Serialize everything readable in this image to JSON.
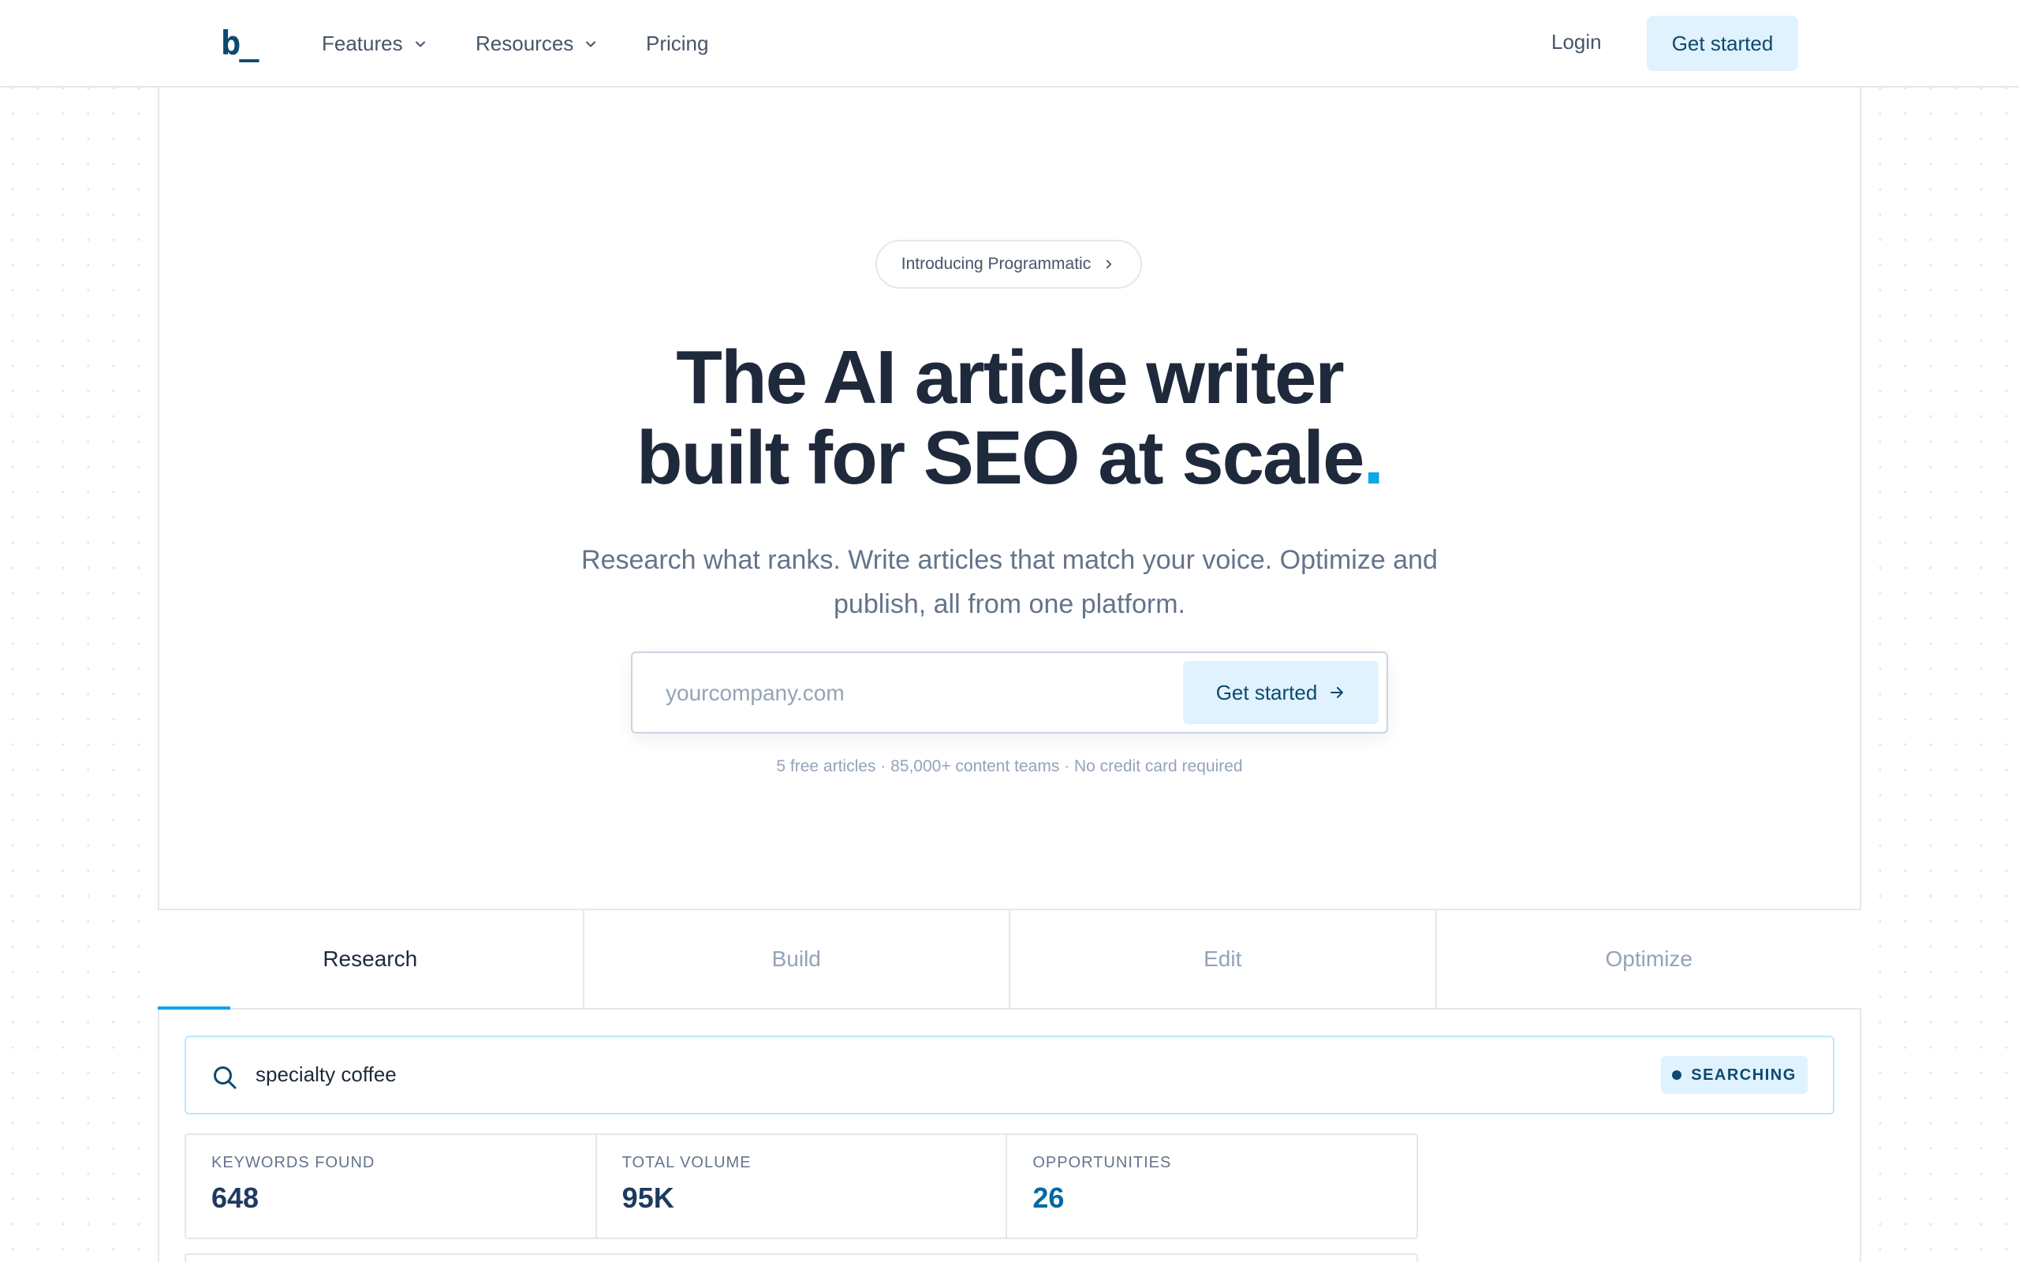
{
  "header": {
    "logo": "b_",
    "nav": [
      {
        "label": "Features",
        "has_dropdown": true
      },
      {
        "label": "Resources",
        "has_dropdown": true
      },
      {
        "label": "Pricing",
        "has_dropdown": false
      }
    ],
    "login_label": "Login",
    "cta_label": "Get started"
  },
  "hero": {
    "pill_label": "Introducing Programmatic",
    "title_line1": "The AI article writer",
    "title_line2": "built for SEO at scale",
    "title_dot": ".",
    "subtitle": "Research what ranks. Write articles that match your voice. Optimize and publish, all from one platform.",
    "email_placeholder": "yourcompany.com",
    "form_cta_label": "Get started",
    "fine_print": "5 free articles · 85,000+ content teams · No credit card required"
  },
  "tabs": [
    {
      "label": "Research",
      "active": true
    },
    {
      "label": "Build",
      "active": false
    },
    {
      "label": "Edit",
      "active": false
    },
    {
      "label": "Optimize",
      "active": false
    }
  ],
  "demo": {
    "search_query": "specialty coffee",
    "status": "SEARCHING",
    "stats": [
      {
        "label": "KEYWORDS FOUND",
        "value": "648"
      },
      {
        "label": "TOTAL VOLUME",
        "value": "95K"
      },
      {
        "label": "OPPORTUNITIES",
        "value": "26"
      }
    ]
  },
  "colors": {
    "brand_dark": "#0c4a6e",
    "accent": "#0ea5e9",
    "cta_bg": "#e0f2fe",
    "heading": "#1e293b",
    "muted": "#64748b"
  },
  "icons": [
    "chevron-down-icon",
    "chevron-right-icon",
    "arrow-right-icon",
    "search-icon",
    "status-dot-icon"
  ]
}
